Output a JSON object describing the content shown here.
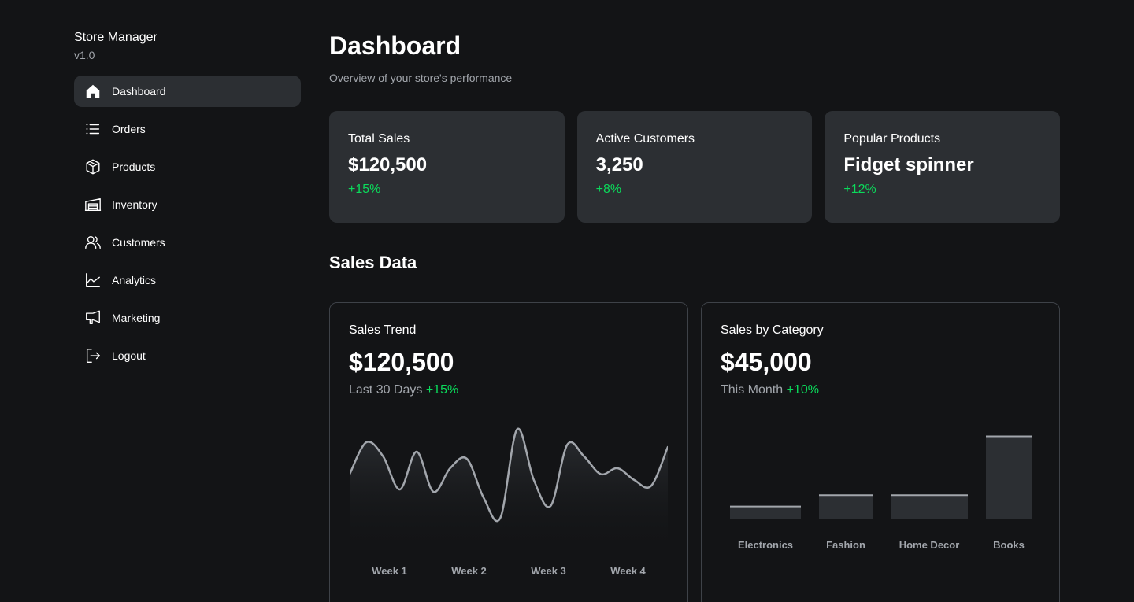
{
  "sidebar": {
    "brand_title": "Store Manager",
    "brand_version": "v1.0",
    "items": [
      {
        "label": "Dashboard",
        "icon": "home-icon",
        "active": true
      },
      {
        "label": "Orders",
        "icon": "list-icon"
      },
      {
        "label": "Products",
        "icon": "package-icon"
      },
      {
        "label": "Inventory",
        "icon": "warehouse-icon"
      },
      {
        "label": "Customers",
        "icon": "users-icon"
      },
      {
        "label": "Analytics",
        "icon": "chart-line-icon"
      },
      {
        "label": "Marketing",
        "icon": "megaphone-icon"
      },
      {
        "label": "Logout",
        "icon": "logout-icon"
      }
    ]
  },
  "header": {
    "title": "Dashboard",
    "subtitle": "Overview of your store's performance"
  },
  "stats": [
    {
      "label": "Total Sales",
      "value": "$120,500",
      "change": "+15%"
    },
    {
      "label": "Active Customers",
      "value": "3,250",
      "change": "+8%"
    },
    {
      "label": "Popular Products",
      "value": "Fidget spinner",
      "change": "+12%"
    }
  ],
  "sales_section": {
    "title": "Sales Data"
  },
  "trend_card": {
    "label": "Sales Trend",
    "value": "$120,500",
    "period": "Last 30 Days",
    "change": "+15%"
  },
  "category_card": {
    "label": "Sales by Category",
    "value": "$45,000",
    "period": "This Month",
    "change": "+10%"
  },
  "colors": {
    "accent_positive": "#0bda5b",
    "card_bg": "#2c2f33",
    "page_bg": "#131416",
    "muted_text": "#a2a6ac"
  },
  "chart_data": [
    {
      "type": "line",
      "title": "Sales Trend",
      "x": [
        0,
        1,
        2,
        3,
        4,
        5,
        6,
        7,
        8,
        9,
        10,
        11,
        12,
        13,
        14,
        15,
        16,
        17,
        18,
        19
      ],
      "values": [
        0.55,
        0.82,
        0.7,
        0.42,
        0.74,
        0.4,
        0.6,
        0.68,
        0.35,
        0.18,
        0.93,
        0.5,
        0.28,
        0.8,
        0.7,
        0.55,
        0.6,
        0.5,
        0.45,
        0.78
      ],
      "tick_labels": [
        "Week 1",
        "Week 2",
        "Week 3",
        "Week 4"
      ],
      "ylim": [
        0,
        1
      ],
      "grid": false
    },
    {
      "type": "bar",
      "title": "Sales by Category",
      "categories": [
        "Electronics",
        "Fashion",
        "Home Decor",
        "Books"
      ],
      "values": [
        14,
        27,
        27,
        95
      ],
      "ylim": [
        0,
        100
      ],
      "grid": false
    }
  ]
}
